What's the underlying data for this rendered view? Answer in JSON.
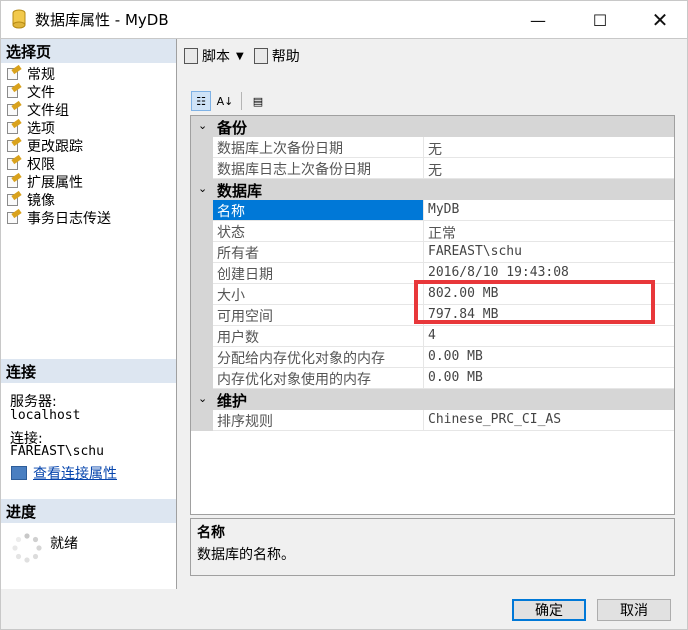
{
  "window": {
    "title": "数据库属性 - MyDB"
  },
  "left": {
    "select_page_header": "选择页",
    "pages": [
      "常规",
      "文件",
      "文件组",
      "选项",
      "更改跟踪",
      "权限",
      "扩展属性",
      "镜像",
      "事务日志传送"
    ],
    "connection_header": "连接",
    "server_label": "服务器:",
    "server_value": "localhost",
    "connection_label": "连接:",
    "connection_value": "FAREAST\\schu",
    "view_connection_link": "查看连接属性",
    "progress_header": "进度",
    "progress_status": "就绪"
  },
  "toolbar": {
    "script_label": "脚本",
    "help_label": "帮助"
  },
  "grid": {
    "categories": [
      {
        "name": "备份",
        "props": [
          {
            "name": "数据库上次备份日期",
            "value": "无"
          },
          {
            "name": "数据库日志上次备份日期",
            "value": "无"
          }
        ]
      },
      {
        "name": "数据库",
        "props": [
          {
            "name": "名称",
            "value": "MyDB"
          },
          {
            "name": "状态",
            "value": "正常"
          },
          {
            "name": "所有者",
            "value": "FAREAST\\schu"
          },
          {
            "name": "创建日期",
            "value": "2016/8/10 19:43:08"
          },
          {
            "name": "大小",
            "value": "802.00 MB"
          },
          {
            "name": "可用空间",
            "value": "797.84 MB"
          },
          {
            "name": "用户数",
            "value": "4"
          },
          {
            "name": "分配给内存优化对象的内存",
            "value": "0.00 MB"
          },
          {
            "name": "内存优化对象使用的内存",
            "value": "0.00 MB"
          }
        ]
      },
      {
        "name": "维护",
        "props": [
          {
            "name": "排序规则",
            "value": "Chinese_PRC_CI_AS"
          }
        ]
      }
    ]
  },
  "description": {
    "title": "名称",
    "text": "数据库的名称。"
  },
  "buttons": {
    "ok": "确定",
    "cancel": "取消"
  },
  "colors": {
    "selection": "#0078d7",
    "highlight_box": "#e8373a",
    "header_bg": "#dde6f1"
  }
}
